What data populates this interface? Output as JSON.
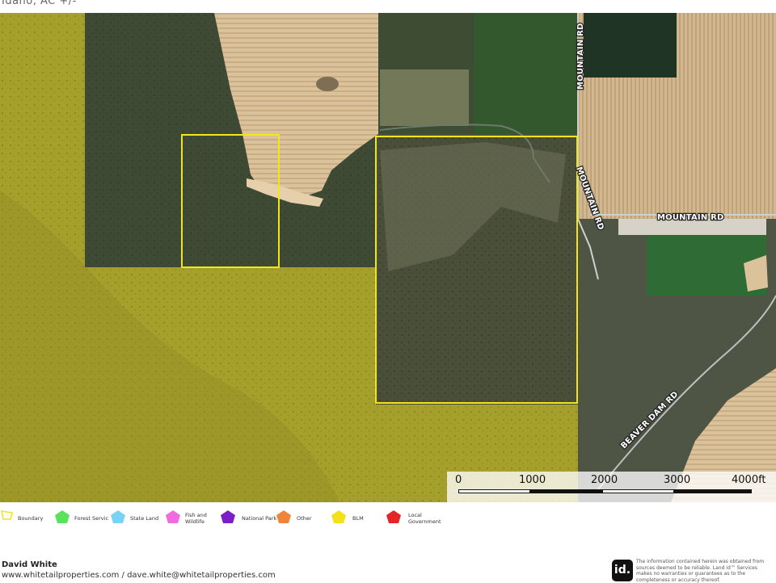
{
  "header": {
    "title": "Idaho,  AC +/-"
  },
  "roads": {
    "mountain_rd_1": "MOUNTAIN RD",
    "mountain_rd_2": "MOUNTAIN RD",
    "mountain_rd_3": "MOUNTAIN RD",
    "beaver_dam_rd": "BEAVER DAM RD"
  },
  "scale": {
    "labels": [
      "0",
      "1000",
      "2000",
      "3000",
      "4000ft"
    ]
  },
  "legend": {
    "items": [
      {
        "label": "Boundary",
        "color": "#f1e51b",
        "shape": "boundary-outline"
      },
      {
        "label": "Forest Servic",
        "color": "#59e35a",
        "shape": "pentagon"
      },
      {
        "label": "State Land",
        "color": "#79d3f7",
        "shape": "pentagon"
      },
      {
        "label": "Fish and Wildlife",
        "color": "#f06ae0",
        "shape": "pentagon"
      },
      {
        "label": "National Park",
        "color": "#7a1fc7",
        "shape": "pentagon"
      },
      {
        "label": "Other",
        "color": "#f0843a",
        "shape": "pentagon"
      },
      {
        "label": "BLM",
        "color": "#f3e21b",
        "shape": "pentagon"
      },
      {
        "label": "Local Government",
        "color": "#e42527",
        "shape": "pentagon"
      }
    ]
  },
  "footer": {
    "name": "David White",
    "contact": "www.whitetailproperties.com / dave.white@whitetailproperties.com",
    "logo_text": "id.",
    "disclaimer": "The information contained herein was obtained from sources deemed to be reliable. Land id™ Services makes no warranties or guarantees as to the completeness or accuracy thereof."
  },
  "colors": {
    "boundary": "#f1e51b",
    "blm_overlay": "#c8c21c"
  }
}
